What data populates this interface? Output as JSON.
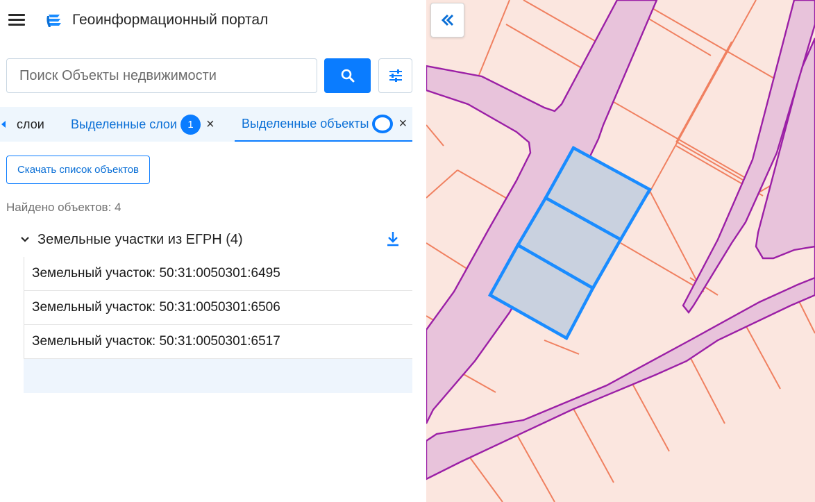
{
  "header": {
    "title": "Геоинформационный портал",
    "menu_icon": "hamburger-menu-icon",
    "logo_icon": "portal-logo-icon"
  },
  "search": {
    "placeholder": "Поиск Объекты недвижимости",
    "value": "",
    "search_icon": "search-icon",
    "filter_icon": "filter-sliders-icon"
  },
  "tabs": [
    {
      "label": "слои",
      "active": false
    },
    {
      "label": "Выделенные слои",
      "badge": "1",
      "active": false
    },
    {
      "label": "Выделенные объекты",
      "badge": "",
      "active": true
    }
  ],
  "tab_close_label": "×",
  "actions": {
    "download_list_label": "Скачать список объектов"
  },
  "results": {
    "found_text": "Найдено объектов: 4",
    "group_title": "Земельные участки из ЕГРН (4)",
    "items": [
      "Земельный участок: 50:31:0050301:6495",
      "Земельный участок: 50:31:0050301:6506",
      "Земельный участок: 50:31:0050301:6517",
      ""
    ]
  },
  "map": {
    "collapse_icon": "double-chevron-left-icon",
    "colors": {
      "background": "#fbe6df",
      "parcel_border": "#f08060",
      "road_fill": "#e8c3db",
      "road_border": "#9b1fa6",
      "selected_fill": "#c9d1df",
      "selected_border": "#1a8cff"
    }
  },
  "colors": {
    "accent": "#0a7cff",
    "tab_background": "#eef6fd"
  }
}
